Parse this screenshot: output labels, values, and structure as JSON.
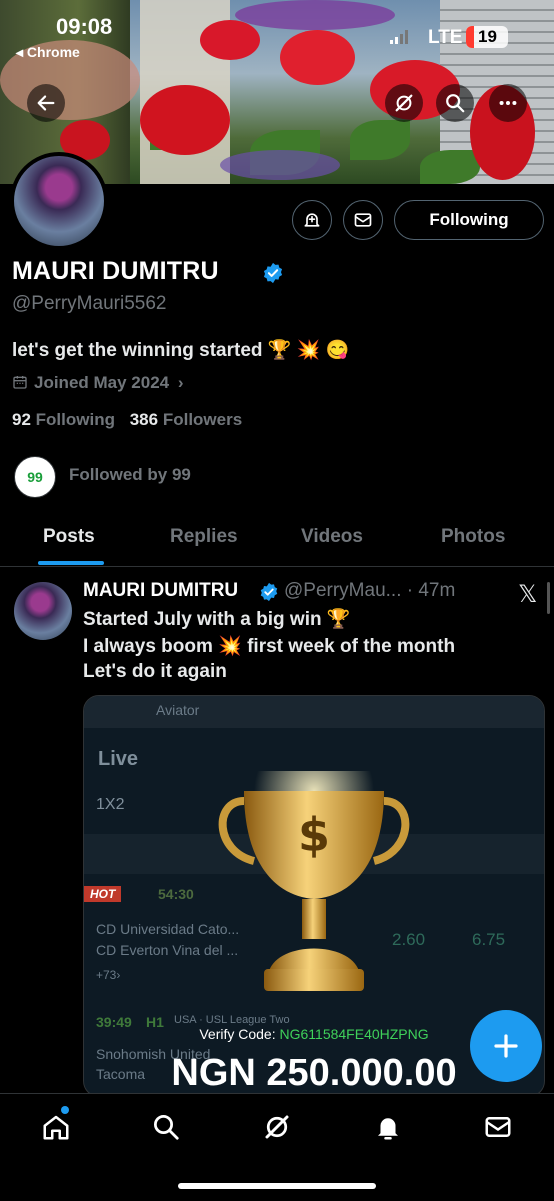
{
  "status_bar": {
    "time": "09:08",
    "back_app": "◂ Chrome",
    "network": "LTE",
    "battery": "19",
    "battery_level": 0.19
  },
  "profile": {
    "name": "MAURI DUMITRU",
    "handle": "@PerryMauri5562",
    "bio": "let's get the winning started 🏆 💥 😋",
    "joined": "Joined May 2024",
    "following_count": "92",
    "following_label": "Following",
    "followers_count": "386",
    "followers_label": "Followers",
    "followed_badge": "99",
    "followed_by": "Followed by 99",
    "follow_button": "Following"
  },
  "tabs": [
    {
      "label": "Posts",
      "active": true
    },
    {
      "label": "Replies",
      "active": false
    },
    {
      "label": "Videos",
      "active": false
    },
    {
      "label": "Photos",
      "active": false
    }
  ],
  "post": {
    "name": "MAURI DUMITRU",
    "handle_time": "@PerryMau... · 47m",
    "lines": [
      "Started July with a big win 🏆",
      "I always boom 💥 first week of the month",
      "Let's do it again"
    ],
    "media": {
      "header": "Aviator",
      "live": "Live",
      "market": "1X2",
      "hot": "HOT",
      "match_time_1": "54:30",
      "team_1a": "CD Universidad Cato...",
      "team_1b": "CD Everton Vina del ...",
      "more_1": "+73›",
      "odds_1a": "2.60",
      "odds_1b": "6.75",
      "match_time_2": "39:49",
      "half_2": "H1",
      "league_2": "USA · USL League Two",
      "team_2a": "Snohomish United",
      "team_2b": "Tacoma",
      "verify_label": "Verify Code:",
      "verify_code": "NG611584FE40HZPNG",
      "amount": "NGN 250.000.00"
    }
  },
  "icons": {
    "back": "arrow-left-icon",
    "grok": "grok-icon",
    "search": "search-icon",
    "more": "more-icon",
    "notify": "notification-bell-plus-icon",
    "message": "envelope-icon",
    "calendar": "calendar-icon",
    "close": "x-logo-icon",
    "compose": "plus-icon"
  },
  "colors": {
    "accent": "#1d9bf0",
    "background": "#000000",
    "muted": "#71767b",
    "success": "#3fd15a"
  }
}
